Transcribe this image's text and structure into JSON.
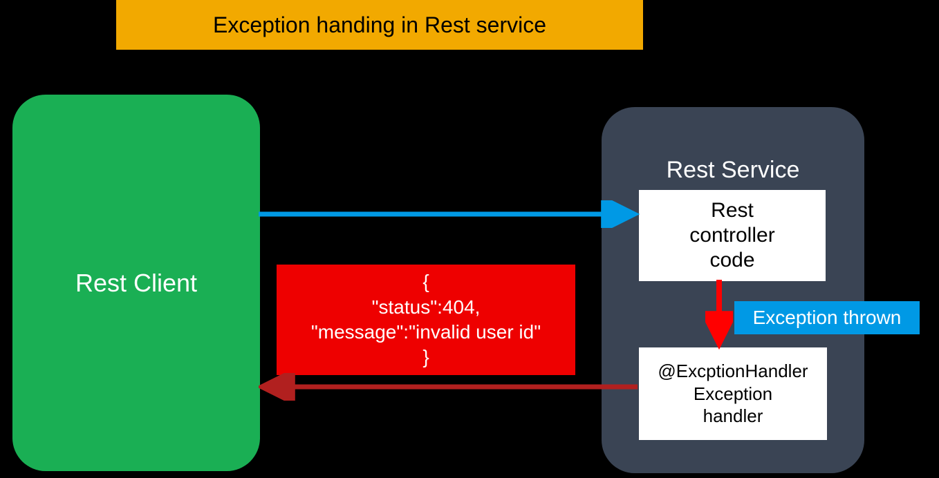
{
  "title": "Exception handing in  Rest service",
  "client": {
    "label": "Rest Client"
  },
  "service": {
    "label": "Rest Service",
    "controller": {
      "line1": "Rest",
      "line2": "controller",
      "line3": "code"
    },
    "handler": {
      "line1": "@ExcptionHandler",
      "line2": "Exception",
      "line3": "handler"
    }
  },
  "exception_label": "Exception thrown",
  "error_response": {
    "brace_open": "{",
    "status_line": "\"status\":404,",
    "message_line": "\"message\":\"invalid user id\"",
    "brace_close": "}"
  },
  "colors": {
    "title_bg": "#f2a900",
    "client_bg": "#1aaf54",
    "service_bg": "#3a4454",
    "accent_blue": "#0099e5",
    "error_red": "#ee0000",
    "arrow_red": "#ff0000",
    "arrow_darkred": "#b1201f"
  }
}
